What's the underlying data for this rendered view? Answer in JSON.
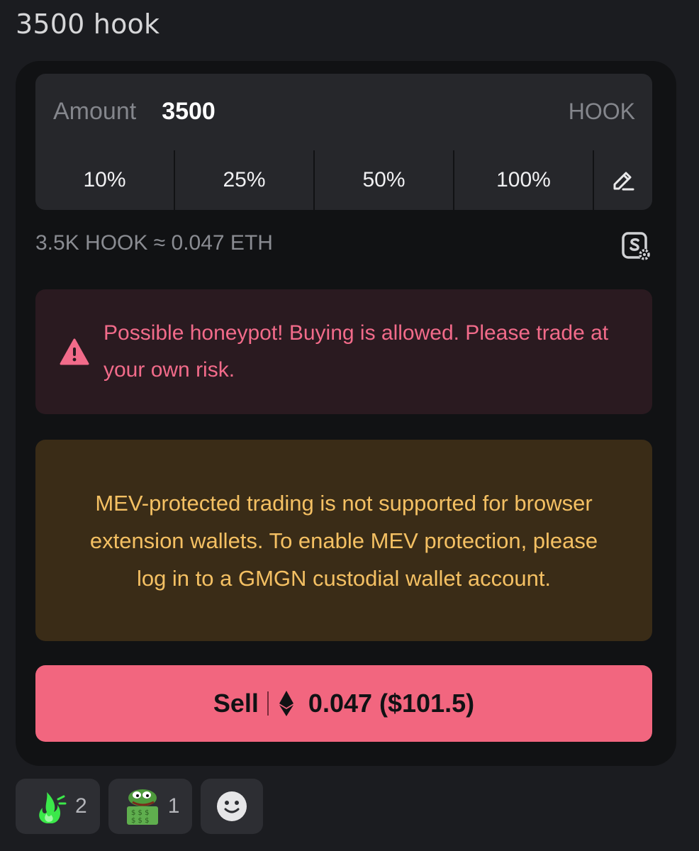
{
  "message": {
    "title": "3500 hook"
  },
  "trade": {
    "amount_label": "Amount",
    "amount_value": "3500",
    "amount_unit": "HOOK",
    "percent_options": [
      "10%",
      "25%",
      "50%",
      "100%"
    ],
    "conversion": "3.5K HOOK ≈ 0.047 ETH"
  },
  "warning": {
    "text": "Possible honeypot! Buying is allowed. Please trade at your own risk."
  },
  "mev_notice": {
    "text": "MEV-protected trading is not supported for browser extension wallets. To enable MEV protection, please log in to a GMGN custodial wallet account."
  },
  "sell_button": {
    "label": "Sell",
    "amount": "0.047 ($101.5)"
  },
  "reactions": [
    {
      "emoji": "green-flame-emoji",
      "count": "2"
    },
    {
      "emoji": "pepe-money-emoji",
      "count": "1"
    }
  ],
  "colors": {
    "accent_sell": "#f2667f",
    "warning_text": "#f26b8a",
    "mev_text": "#f4c063"
  }
}
